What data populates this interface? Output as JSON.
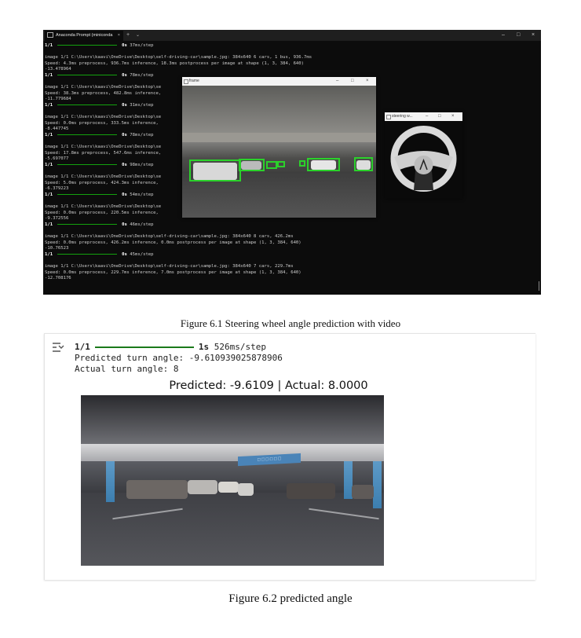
{
  "figure1": {
    "caption": "Figure 6.1 Steering wheel angle prediction with video",
    "terminal": {
      "tab_title": "Anaconda Prompt (miniconda",
      "tab_close": "×",
      "new_tab": "+",
      "tab_menu": "⌄",
      "lines": [
        {
          "type": "progress",
          "step": "1/1",
          "time": "0s",
          "rate": "37ms/step"
        },
        {
          "type": "blank"
        },
        {
          "type": "text",
          "text": "image 1/1 C:\\Users\\kaavi\\OneDrive\\Desktop\\self-driving-car\\sample.jpg: 384x640 6 cars, 1 bus, 936.7ms"
        },
        {
          "type": "text",
          "text": "Speed: 4.3ms preprocess, 936.7ms inference, 18.3ms postprocess per image at shape (1, 3, 384, 640)"
        },
        {
          "type": "text",
          "text": "-13.478964"
        },
        {
          "type": "progress",
          "step": "1/1",
          "time": "0s",
          "rate": "78ms/step"
        },
        {
          "type": "blank"
        },
        {
          "type": "text",
          "text": "image 1/1 C:\\Users\\kaavi\\OneDrive\\Desktop\\se"
        },
        {
          "type": "text",
          "text": "Speed: 38.3ms preprocess, 482.8ms inference,"
        },
        {
          "type": "text",
          "text": "-11.779684"
        },
        {
          "type": "progress",
          "step": "1/1",
          "time": "0s",
          "rate": "31ms/step"
        },
        {
          "type": "blank"
        },
        {
          "type": "text",
          "text": "image 1/1 C:\\Users\\kaavi\\OneDrive\\Desktop\\se"
        },
        {
          "type": "text",
          "text": "Speed: 0.0ms preprocess, 333.5ms inference,"
        },
        {
          "type": "text",
          "text": "-8.447745"
        },
        {
          "type": "progress",
          "step": "1/1",
          "time": "0s",
          "rate": "78ms/step"
        },
        {
          "type": "blank"
        },
        {
          "type": "text",
          "text": "image 1/1 C:\\Users\\kaavi\\OneDrive\\Desktop\\se"
        },
        {
          "type": "text",
          "text": "Speed: 17.8ms preprocess, 547.6ms inference,"
        },
        {
          "type": "text",
          "text": "-5.697077"
        },
        {
          "type": "progress",
          "step": "1/1",
          "time": "0s",
          "rate": "98ms/step"
        },
        {
          "type": "blank"
        },
        {
          "type": "text",
          "text": "image 1/1 C:\\Users\\kaavi\\OneDrive\\Desktop\\se"
        },
        {
          "type": "text",
          "text": "Speed: 5.0ms preprocess, 424.3ms inference,"
        },
        {
          "type": "text",
          "text": "-6.379223"
        },
        {
          "type": "progress",
          "step": "1/1",
          "time": "0s",
          "rate": "54ms/step"
        },
        {
          "type": "blank"
        },
        {
          "type": "text",
          "text": "image 1/1 C:\\Users\\kaavi\\OneDrive\\Desktop\\se"
        },
        {
          "type": "text",
          "text": "Speed: 0.0ms preprocess, 220.5ms inference,"
        },
        {
          "type": "text",
          "text": "-9.372556"
        },
        {
          "type": "progress",
          "step": "1/1",
          "time": "0s",
          "rate": "46ms/step"
        },
        {
          "type": "blank"
        },
        {
          "type": "text",
          "text": "image 1/1 C:\\Users\\kaavi\\OneDrive\\Desktop\\self-driving-car\\sample.jpg: 384x640 8 cars, 426.2ms"
        },
        {
          "type": "text",
          "text": "Speed: 0.0ms preprocess, 426.2ms inference, 0.0ms postprocess per image at shape (1, 3, 384, 640)"
        },
        {
          "type": "text",
          "text": "-10.76523"
        },
        {
          "type": "progress",
          "step": "1/1",
          "time": "0s",
          "rate": "45ms/step"
        },
        {
          "type": "blank"
        },
        {
          "type": "text",
          "text": "image 1/1 C:\\Users\\kaavi\\OneDrive\\Desktop\\self-driving-car\\sample.jpg: 384x640 7 cars, 229.7ms"
        },
        {
          "type": "text",
          "text": "Speed: 0.0ms preprocess, 229.7ms inference, 7.0ms postprocess per image at shape (1, 3, 384, 640)"
        },
        {
          "type": "text",
          "text": "-12.708176"
        }
      ]
    },
    "frame_window": {
      "title": "frame"
    },
    "steering_window": {
      "title": "steering w..."
    },
    "window_controls": {
      "minimize": "–",
      "maximize": "□",
      "close": "×"
    }
  },
  "figure2": {
    "caption": "Figure 6.2 predicted angle",
    "progress": {
      "step": "1/1",
      "time": "1s",
      "rate": "526ms/step"
    },
    "predicted_line": "Predicted turn angle: -9.610939025878906",
    "actual_line": "Actual turn angle: 8",
    "plot_title": "Predicted: -9.6109 | Actual: 8.0000",
    "sign_text": "□ □ □ □ □ □"
  },
  "colors": {
    "terminal_bg": "#0c0c0c",
    "progress_green": "#13a10e",
    "bbox_green": "#2bd12b"
  }
}
